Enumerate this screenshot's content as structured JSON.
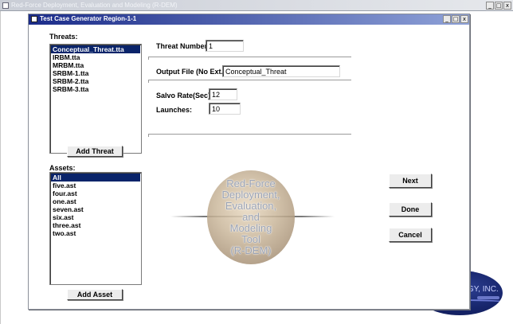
{
  "outer_window": {
    "title": "Red-Force Deployment, Evaluation and Modeling (R-DEM)",
    "min_label": "_",
    "max_label": "□",
    "close_label": "x",
    "watermark_logo_text": "GY, INC."
  },
  "dialog": {
    "title": "Test Case Generator Region-1-1",
    "min_label": "_",
    "max_label": "□",
    "close_label": "x"
  },
  "threats": {
    "label": "Threats:",
    "items": [
      "Conceptual_Threat.tta",
      "IRBM.tta",
      "MRBM.tta",
      "SRBM-1.tta",
      "SRBM-2.tta",
      "SRBM-3.tta"
    ],
    "selected_index": 0,
    "add_button": "Add Threat"
  },
  "assets": {
    "label": "Assets:",
    "items": [
      "All",
      "five.ast",
      "four.ast",
      "one.ast",
      "seven.ast",
      "six.ast",
      "three.ast",
      "two.ast"
    ],
    "selected_index": 0,
    "add_button": "Add Asset"
  },
  "form": {
    "threat_number_label": "Threat Number:",
    "threat_number_value": "1",
    "output_file_label": "Output File (No Ext.):",
    "output_file_value": "Conceptual_Threat",
    "salvo_rate_label": "Salvo Rate(Sec):",
    "salvo_rate_value": "12",
    "launches_label": "Launches:",
    "launches_value": "10"
  },
  "buttons": {
    "next": "Next",
    "done": "Done",
    "cancel": "Cancel"
  },
  "emblem": {
    "lines": [
      "Red-Force",
      "Deployment,",
      "Evaluation,",
      "and",
      "Modeling",
      "Tool",
      "(R-DEM)"
    ]
  }
}
